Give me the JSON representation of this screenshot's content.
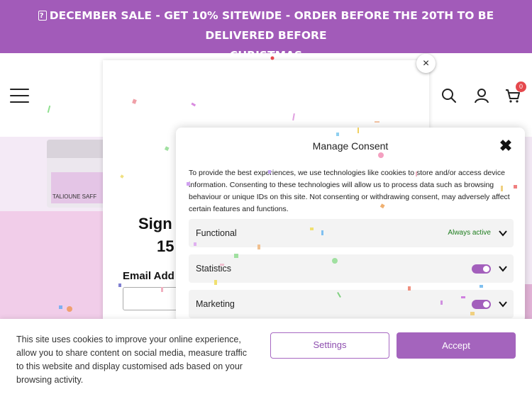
{
  "promo": {
    "line1": "DECEMBER SALE - GET 10% SITEWIDE - ORDER BEFORE THE 20TH TO BE DELIVERED BEFORE",
    "line2": "CHRISTMAS",
    "icon": "gift-icon"
  },
  "header": {
    "menu_icon": "hamburger-menu-icon",
    "search_icon": "search-icon",
    "account_icon": "user-icon",
    "cart_icon": "cart-icon",
    "cart_count": "0"
  },
  "hero": {
    "product_label": "TALIOUNE SAFF"
  },
  "newsletter": {
    "title": "Sign",
    "subtitle": "15",
    "email_label": "Email Add",
    "close_symbol": "×"
  },
  "consent": {
    "title": "Manage Consent",
    "close_symbol": "✖",
    "body": "To provide the best experiences, we use technologies like cookies to store and/or access device information. Consenting to these technologies will allow us to process data such as browsing behaviour or unique IDs on this site. Not consenting or withdrawing consent, may adversely affect certain features and functions.",
    "categories": [
      {
        "label": "Functional",
        "status": "Always active"
      },
      {
        "label": "Statistics",
        "enabled": true
      },
      {
        "label": "Marketing",
        "enabled": true
      }
    ]
  },
  "cookie_bar": {
    "text": "This site uses cookies to improve your online experience, allow you to share content on social media, measure traffic to this website and display customised ads based on your browsing activity.",
    "settings_label": "Settings",
    "accept_label": "Accept"
  },
  "colors": {
    "brand_purple": "#a25bb9",
    "accept_button": "#a464bd",
    "always_active": "#1e7d1e",
    "cart_badge": "#e5484d"
  }
}
